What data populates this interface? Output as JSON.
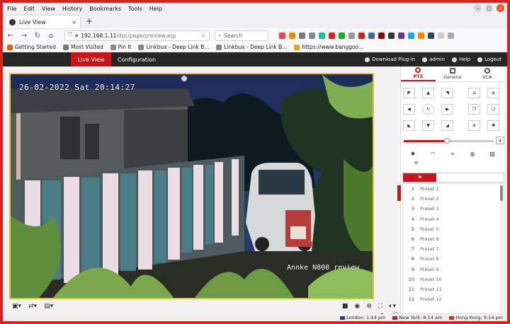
{
  "browser": {
    "menu": [
      {
        "label": "File",
        "key": "F"
      },
      {
        "label": "Edit",
        "key": "E"
      },
      {
        "label": "View",
        "key": "V"
      },
      {
        "label": "History",
        "key": "s"
      },
      {
        "label": "Bookmarks",
        "key": "B"
      },
      {
        "label": "Tools",
        "key": "T"
      },
      {
        "label": "Help",
        "key": "H"
      }
    ],
    "tab_title": "Live View",
    "url_host": "192.168.1.11",
    "url_path": "/doc/page/preview.asp",
    "search_placeholder": "Search",
    "bookmarks": [
      "Getting Started",
      "Most Visited",
      "Pin It",
      "Linkbux - Deep Link B...",
      "Linkbux - Deep Link B...",
      "https://www.banggoo..."
    ]
  },
  "app": {
    "nav": {
      "live_view": "Live View",
      "configuration": "Configuration"
    },
    "header_right": {
      "download": "Download Plug-in",
      "user": "admin",
      "help": "Help",
      "logout": "Logout"
    },
    "osd_timestamp": "26-02-2022 Sat 20:14:27",
    "osd_camera_name": "Annke N800 review",
    "panel_tabs": [
      "PTZ",
      "General",
      "VCA"
    ],
    "ptz_speed": "4",
    "ptz_speed_level": 0.48,
    "presets": [
      "Preset 1",
      "Preset 2",
      "Preset 3",
      "Preset 4",
      "Preset 5",
      "Preset 6",
      "Preset 7",
      "Preset 8",
      "Preset 9",
      "Preset 10",
      "Preset 11",
      "Preset 12"
    ]
  },
  "status": {
    "london": "London: 1:14 pm",
    "new_york": "New York: 8:14 am",
    "hong_kong": "Hong Kong: 9:14 pm"
  },
  "colors": {
    "accent": "#c8151b",
    "frame": "#e0201e",
    "video_border": "#e7c32a"
  }
}
